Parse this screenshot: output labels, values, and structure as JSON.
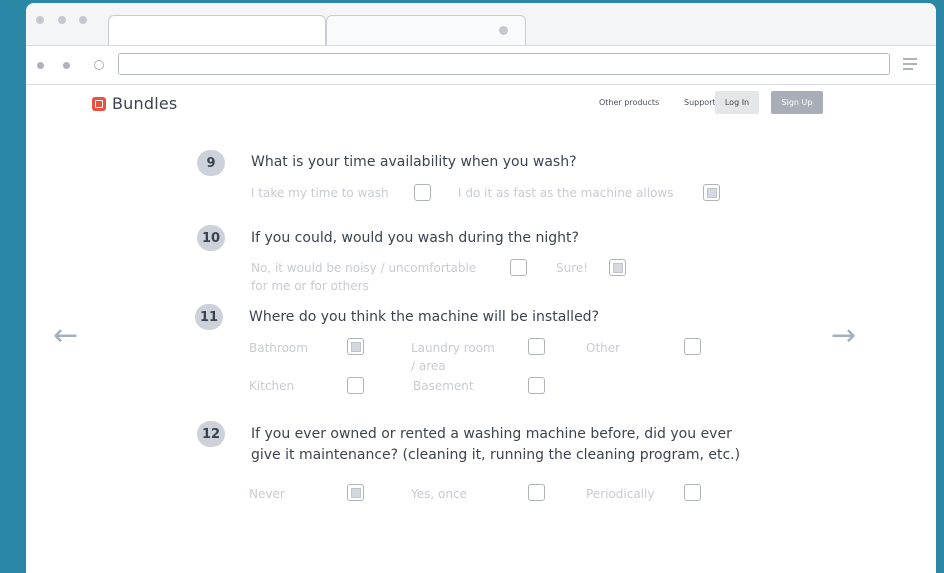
{
  "brand": {
    "name": "Bundles"
  },
  "nav": {
    "other_products": "Other products",
    "support": "Support",
    "login": "Log In",
    "signup": "Sign Up"
  },
  "questions": [
    {
      "number": "9",
      "text": "What is your time availability when you wash?",
      "options": [
        {
          "label": "I take my time to wash",
          "checked": false
        },
        {
          "label": "I do it as fast as the machine allows",
          "checked": true
        }
      ]
    },
    {
      "number": "10",
      "text": "If you could, would you wash during the night?",
      "options": [
        {
          "label_line1": "No, it would be noisy / uncomfortable",
          "label_line2": "for me or for others",
          "checked": false
        },
        {
          "label": "Sure!",
          "checked": true
        }
      ]
    },
    {
      "number": "11",
      "text": "Where do you think the machine will be installed?",
      "options": [
        {
          "label": "Bathroom",
          "checked": true
        },
        {
          "label_line1": "Laundry room",
          "label_line2": "/ area",
          "checked": false
        },
        {
          "label": "Other",
          "checked": false
        },
        {
          "label": "Kitchen",
          "checked": false
        },
        {
          "label": "Basement",
          "checked": false
        }
      ]
    },
    {
      "number": "12",
      "text_line1": "If you ever owned or rented a washing machine before, did you ever",
      "text_line2": "give it maintenance? (cleaning it, running the cleaning program, etc.)",
      "options": [
        {
          "label": "Never",
          "checked": true
        },
        {
          "label": "Yes, once",
          "checked": false
        },
        {
          "label": "Periodically",
          "checked": false
        }
      ]
    }
  ],
  "colors": {
    "accent": "#e8523f",
    "background": "#2a87a6"
  }
}
